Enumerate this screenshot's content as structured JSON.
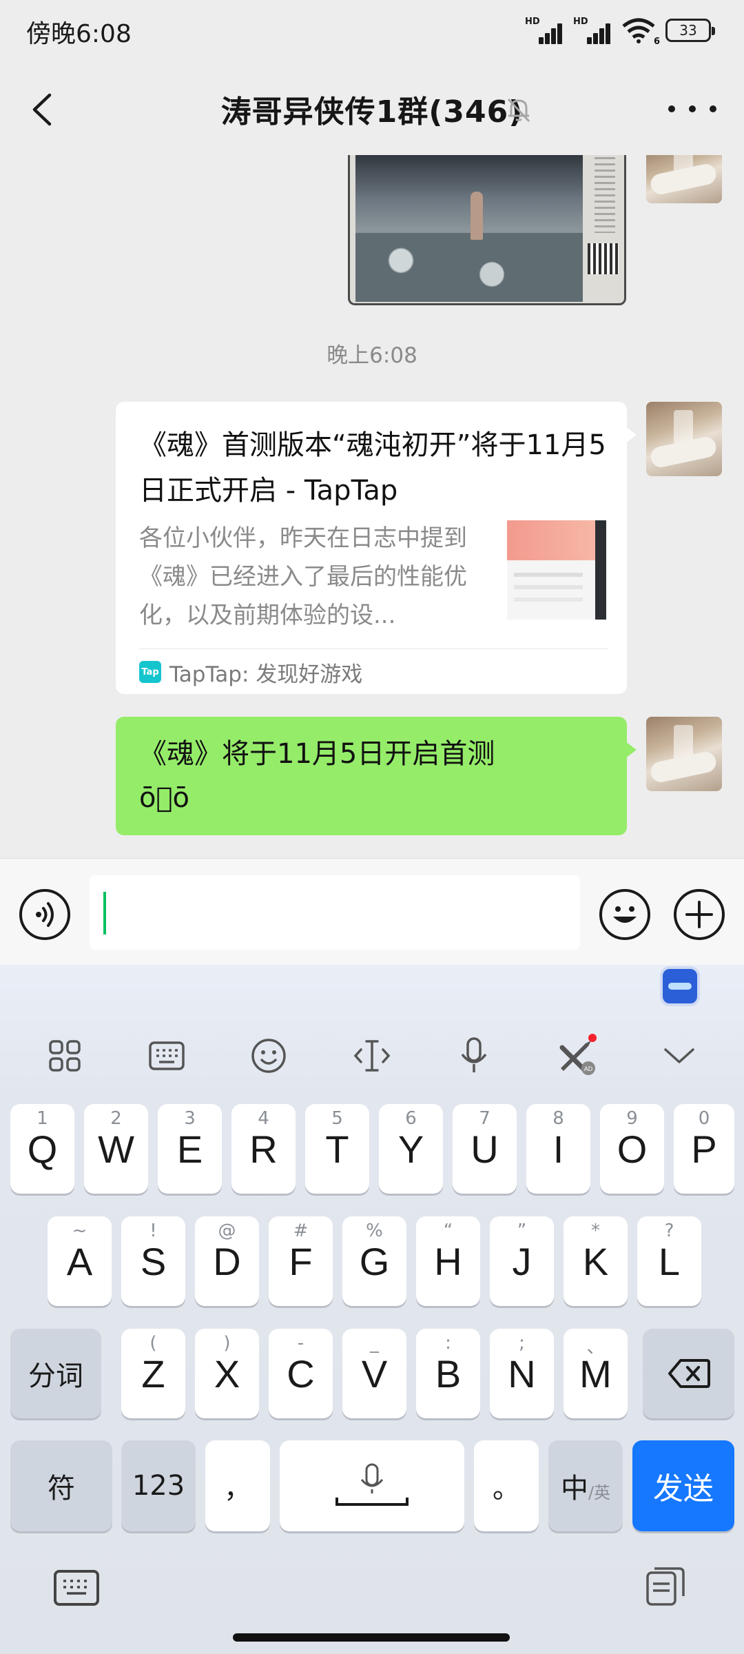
{
  "status_bar": {
    "time": "傍晚6:08",
    "signal1_label": "HD",
    "signal2_label": "HD",
    "wifi_label": "6",
    "battery": "33",
    "icons": [
      "signal-icon",
      "signal-icon",
      "wifi-icon",
      "battery-icon"
    ]
  },
  "chat": {
    "title": "涛哥异侠传1群(346)",
    "muted": true
  },
  "messages": {
    "timestamp": "晚上6:08",
    "link_card": {
      "title": "《魂》首测版本“魂沌初开”将于11月5日正式开启 - TapTap",
      "description": "各位小伙伴，昨天在日志中提到《魂》已经进入了最后的性能优化，以及前期体验的设...",
      "source_logo": "Tap",
      "source": "TapTap: 发现好游戏"
    },
    "text_message": "《魂》将于11月5日开启首测\nō\u0000ō"
  },
  "input": {
    "placeholder": "",
    "value": ""
  },
  "keyboard": {
    "toolbar_icons": [
      "grid-icon",
      "keyboard-icon",
      "emoji-icon",
      "cursor-icon",
      "microphone-icon",
      "ad-game-icon",
      "chevron-down-icon"
    ],
    "row1": [
      {
        "key": "Q",
        "sub": "1"
      },
      {
        "key": "W",
        "sub": "2"
      },
      {
        "key": "E",
        "sub": "3"
      },
      {
        "key": "R",
        "sub": "4"
      },
      {
        "key": "T",
        "sub": "5"
      },
      {
        "key": "Y",
        "sub": "6"
      },
      {
        "key": "U",
        "sub": "7"
      },
      {
        "key": "I",
        "sub": "8"
      },
      {
        "key": "O",
        "sub": "9"
      },
      {
        "key": "P",
        "sub": "0"
      }
    ],
    "row2": [
      {
        "key": "A",
        "sub": "~"
      },
      {
        "key": "S",
        "sub": "!"
      },
      {
        "key": "D",
        "sub": "@"
      },
      {
        "key": "F",
        "sub": "#"
      },
      {
        "key": "G",
        "sub": "%"
      },
      {
        "key": "H",
        "sub": "“"
      },
      {
        "key": "J",
        "sub": "”"
      },
      {
        "key": "K",
        "sub": "*"
      },
      {
        "key": "L",
        "sub": "?"
      }
    ],
    "row3": [
      {
        "key": "Z",
        "sub": "("
      },
      {
        "key": "X",
        "sub": ")"
      },
      {
        "key": "C",
        "sub": "-"
      },
      {
        "key": "V",
        "sub": "_"
      },
      {
        "key": "B",
        "sub": ":"
      },
      {
        "key": "N",
        "sub": ";"
      },
      {
        "key": "M",
        "sub": "、"
      }
    ],
    "fenci": "分词",
    "fu": "符",
    "num": "123",
    "comma": "，",
    "period": "。",
    "lang_main": "中",
    "lang_sub": "/英",
    "send": "发送",
    "colors": {
      "send": "#1677ff",
      "bubble": "#95ec69",
      "caret": "#07c160"
    }
  }
}
